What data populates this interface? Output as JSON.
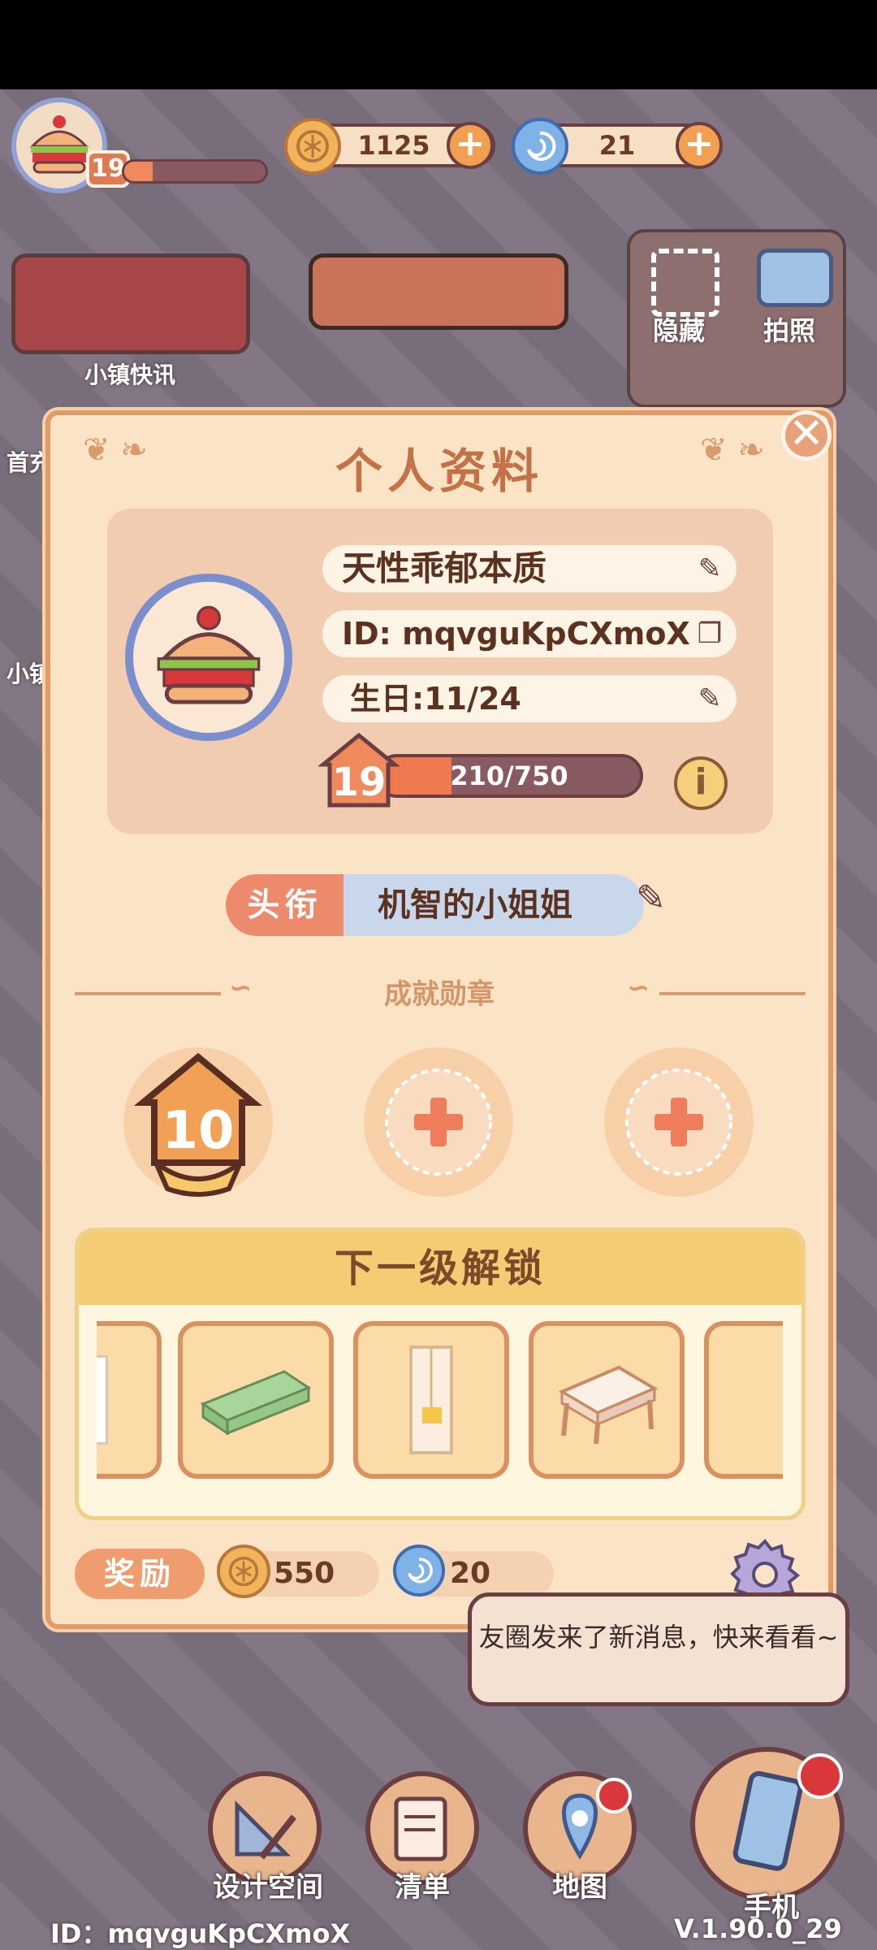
{
  "hud": {
    "level": "19",
    "level_progress": 0.2,
    "coins": "1125",
    "gems": "21",
    "news_label": "小镇快讯",
    "hide_label": "隐藏",
    "photo_label": "拍照"
  },
  "left_partial": {
    "label_a": "首充",
    "label_b": "小镇"
  },
  "profile": {
    "title": "个人资料",
    "nickname": "天性乖郁本质",
    "id_text": "ID: mqvguKpCXmoX",
    "birthday": "生日:11/24",
    "level": "19",
    "xp_text": "210/750",
    "xp_fraction": 0.28,
    "info_icon": "info-icon",
    "title_tag": "头衔",
    "title_value": "机智的小姐姐",
    "achievements_header": "成就勋章",
    "medal_level": "10",
    "unlock_header": "下一级解锁",
    "reward_label": "奖励",
    "reward_coins": "550",
    "reward_gems": "20",
    "close_icon": "close-icon"
  },
  "notice": {
    "text": "友圈发来了新消息，快来看看~"
  },
  "nav": {
    "design": "设计空间",
    "list": "清单",
    "map": "地图",
    "phone": "手机"
  },
  "footer": {
    "id": "ID：mqvguKpCXmoX",
    "version": "V.1.90.0_29"
  },
  "colors": {
    "panel": "#fbe4c6",
    "panel_border": "#e19b68",
    "accent_orange": "#ee8a6c",
    "title_blue": "#c9d7ec",
    "unlock_gold": "#f3cc74"
  }
}
